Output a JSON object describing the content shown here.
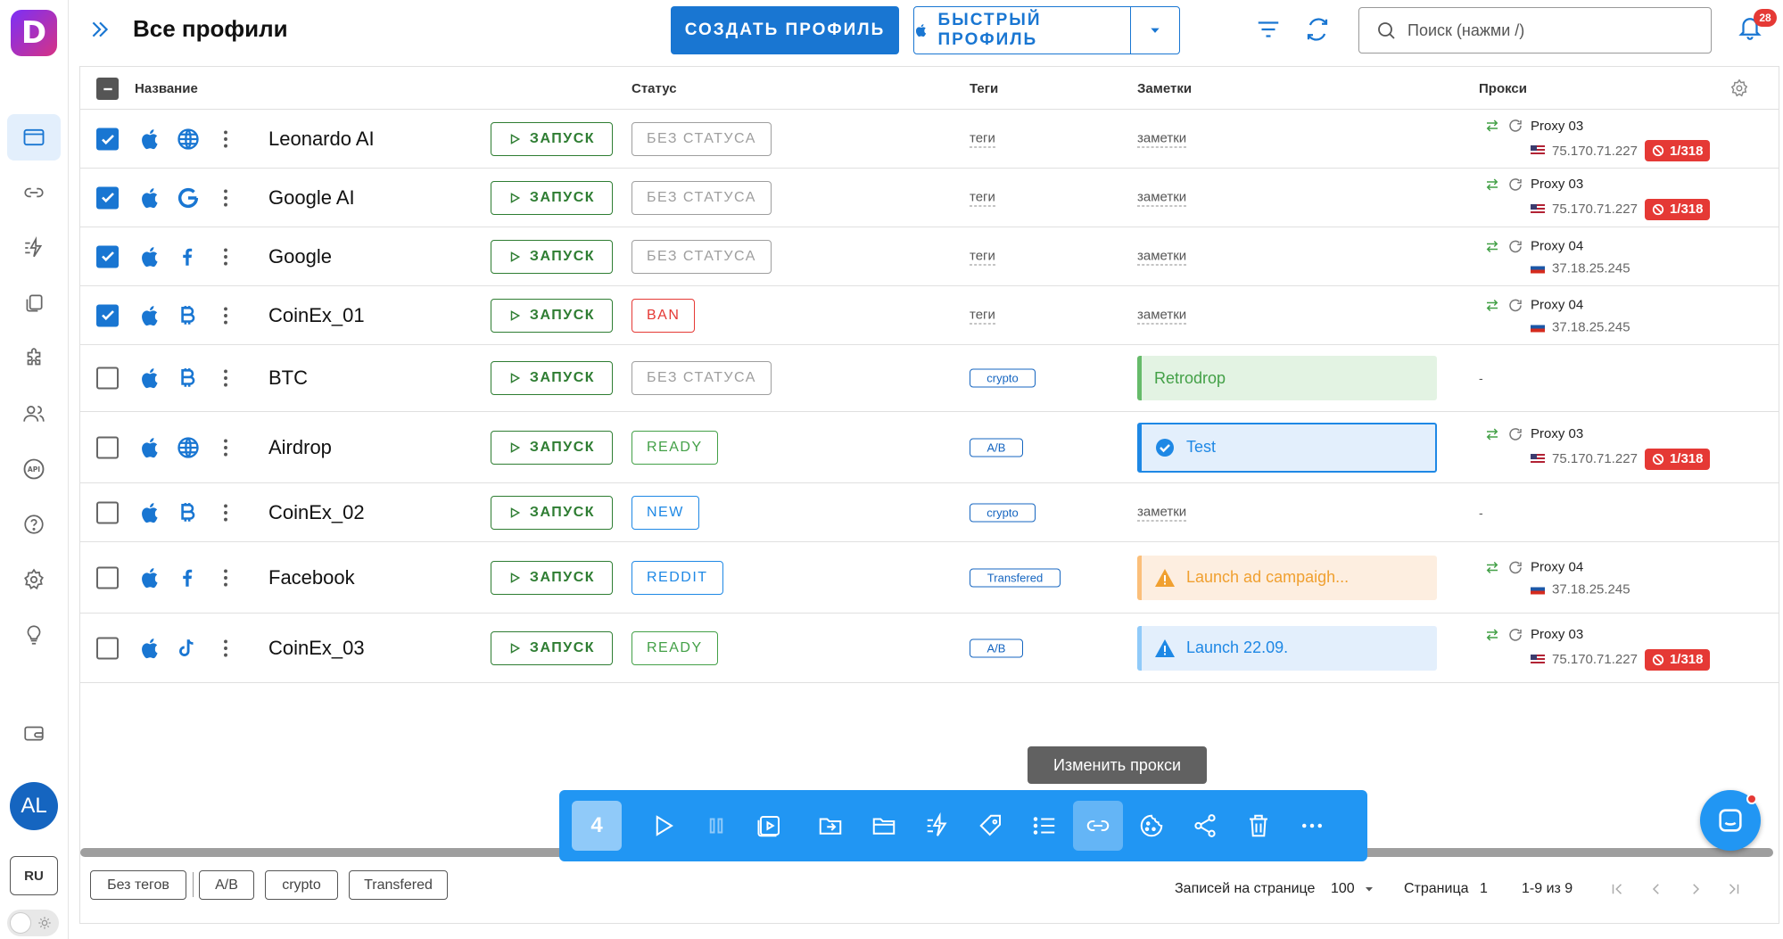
{
  "header": {
    "title": "Все профили",
    "create_label": "СОЗДАТЬ ПРОФИЛЬ",
    "quick_label": "БЫСТРЫЙ ПРОФИЛЬ",
    "search_placeholder": "Поиск (нажми /)",
    "notification_count": "28"
  },
  "sidebar": {
    "logo": "D",
    "avatar": "AL",
    "lang": "RU",
    "items": [
      "profiles",
      "links",
      "automation",
      "clipboard",
      "extensions",
      "team",
      "api",
      "help",
      "settings",
      "tips",
      "wallet"
    ]
  },
  "columns": {
    "name": "Название",
    "status": "Статус",
    "tags": "Теги",
    "notes": "Заметки",
    "proxy": "Прокси"
  },
  "launch_label": "ЗАПУСК",
  "rows": [
    {
      "checked": true,
      "os": "apple-icon",
      "site": "globe-icon",
      "name": "Leonardo AI",
      "status": "БЕЗ СТАТУСА",
      "status_color": "#9e9e9e",
      "tag": "теги",
      "tag_type": "link",
      "note": "заметки",
      "note_type": "link",
      "proxy_name": "Proxy 03",
      "proxy_ip": "75.170.71.227",
      "flag": "us",
      "ban": "1/318"
    },
    {
      "checked": true,
      "os": "apple-icon",
      "site": "google-icon",
      "name": "Google AI",
      "status": "БЕЗ СТАТУСА",
      "status_color": "#9e9e9e",
      "tag": "теги",
      "tag_type": "link",
      "note": "заметки",
      "note_type": "link",
      "proxy_name": "Proxy 03",
      "proxy_ip": "75.170.71.227",
      "flag": "us",
      "ban": "1/318"
    },
    {
      "checked": true,
      "os": "apple-icon",
      "site": "facebook-icon",
      "name": "Google",
      "status": "БЕЗ СТАТУСА",
      "status_color": "#9e9e9e",
      "tag": "теги",
      "tag_type": "link",
      "note": "заметки",
      "note_type": "link",
      "proxy_name": "Proxy 04",
      "proxy_ip": "37.18.25.245",
      "flag": "ru",
      "ban": ""
    },
    {
      "checked": true,
      "os": "apple-icon",
      "site": "bitcoin-icon",
      "name": "CoinEx_01",
      "status": "BAN",
      "status_color": "#e53935",
      "tag": "теги",
      "tag_type": "link",
      "note": "заметки",
      "note_type": "link",
      "proxy_name": "Proxy 04",
      "proxy_ip": "37.18.25.245",
      "flag": "ru",
      "ban": ""
    },
    {
      "checked": false,
      "os": "apple-icon",
      "site": "bitcoin-icon",
      "name": "BTC",
      "status": "БЕЗ СТАТУСА",
      "status_color": "#9e9e9e",
      "tag": "crypto",
      "tag_type": "chip",
      "note": "Retrodrop",
      "note_type": "green",
      "proxy_name": "",
      "proxy_ip": "",
      "flag": "",
      "ban": "",
      "proxy_dash": "-"
    },
    {
      "checked": false,
      "os": "apple-icon",
      "site": "globe-icon",
      "name": "Airdrop",
      "status": "READY",
      "status_color": "#43a047",
      "tag": "A/B",
      "tag_type": "chip",
      "note": "Test",
      "note_type": "blue-check",
      "proxy_name": "Proxy 03",
      "proxy_ip": "75.170.71.227",
      "flag": "us",
      "ban": "1/318"
    },
    {
      "checked": false,
      "os": "apple-icon",
      "site": "bitcoin-icon",
      "name": "CoinEx_02",
      "status": "NEW",
      "status_color": "#1e88e5",
      "tag": "crypto",
      "tag_type": "chip",
      "note": "заметки",
      "note_type": "link",
      "proxy_name": "",
      "proxy_ip": "",
      "flag": "",
      "ban": "",
      "proxy_dash": "-"
    },
    {
      "checked": false,
      "os": "apple-icon",
      "site": "facebook-icon",
      "name": "Facebook",
      "status": "REDDIT",
      "status_color": "#1e88e5",
      "tag": "Transfered",
      "tag_type": "chip",
      "note": "Launch ad campaigh...",
      "note_type": "orange",
      "proxy_name": "Proxy 04",
      "proxy_ip": "37.18.25.245",
      "flag": "ru",
      "ban": ""
    },
    {
      "checked": false,
      "os": "apple-icon",
      "site": "tiktok-icon",
      "name": "CoinEx_03",
      "status": "READY",
      "status_color": "#43a047",
      "tag": "A/B",
      "tag_type": "chip",
      "note": "Launch 22.09.",
      "note_type": "blue-warn",
      "proxy_name": "Proxy 03",
      "proxy_ip": "75.170.71.227",
      "flag": "us",
      "ban": "1/318"
    }
  ],
  "actionbar": {
    "count": "4",
    "tooltip": "Изменить прокси"
  },
  "footer": {
    "chips": [
      "Без тегов",
      "A/B",
      "crypto",
      "Transfered"
    ],
    "per_page_label": "Записей на странице",
    "per_page": "100",
    "page_label": "Страница",
    "page": "1",
    "range": "1-9 из 9"
  },
  "colors": {
    "primary": "#1976d2",
    "green": "#2e7d32",
    "danger": "#e53935"
  }
}
